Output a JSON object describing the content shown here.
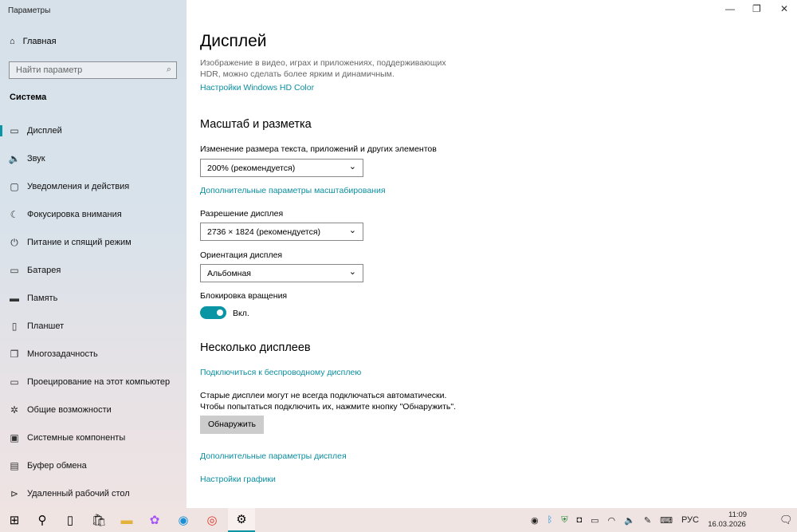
{
  "window": {
    "title": "Параметры",
    "minimize": "—",
    "restore": "❐",
    "close": "✕"
  },
  "sidebar": {
    "home": "Главная",
    "search_placeholder": "Найти параметр",
    "section": "Система",
    "items": [
      {
        "label": "Дисплей",
        "icon": "monitor-icon"
      },
      {
        "label": "Звук",
        "icon": "speaker-icon"
      },
      {
        "label": "Уведомления и действия",
        "icon": "notification-icon"
      },
      {
        "label": "Фокусировка внимания",
        "icon": "moon-icon"
      },
      {
        "label": "Питание и спящий режим",
        "icon": "power-icon"
      },
      {
        "label": "Батарея",
        "icon": "battery-icon"
      },
      {
        "label": "Память",
        "icon": "storage-icon"
      },
      {
        "label": "Планшет",
        "icon": "tablet-icon"
      },
      {
        "label": "Многозадачность",
        "icon": "multitask-icon"
      },
      {
        "label": "Проецирование на этот компьютер",
        "icon": "project-icon"
      },
      {
        "label": "Общие возможности",
        "icon": "shared-icon"
      },
      {
        "label": "Системные компоненты",
        "icon": "components-icon"
      },
      {
        "label": "Буфер обмена",
        "icon": "clipboard-icon"
      },
      {
        "label": "Удаленный рабочий стол",
        "icon": "remote-icon"
      }
    ]
  },
  "main": {
    "title": "Дисплей",
    "hdr_desc1": "Изображение в видео, играх и приложениях, поддерживающих",
    "hdr_desc2": "HDR, можно сделать более ярким и динамичным.",
    "hdr_link": "Настройки Windows HD Color",
    "scale_heading": "Масштаб и разметка",
    "scale_label": "Изменение размера текста, приложений и других элементов",
    "scale_value": "200% (рекомендуется)",
    "scale_link": "Дополнительные параметры масштабирования",
    "res_label": "Разрешение дисплея",
    "res_value": "2736 × 1824 (рекомендуется)",
    "orient_label": "Ориентация дисплея",
    "orient_value": "Альбомная",
    "rot_label": "Блокировка вращения",
    "rot_state": "Вкл.",
    "rot_on": true,
    "multi_heading": "Несколько дисплеев",
    "wireless_link": "Подключиться к беспроводному дисплею",
    "old_desc1": "Старые дисплеи могут не всегда подключаться автоматически.",
    "old_desc2": "Чтобы попытаться подключить их, нажмите кнопку \"Обнаружить\".",
    "detect_button": "Обнаружить",
    "adv_link": "Дополнительные параметры дисплея",
    "graphics_link": "Настройки графики"
  },
  "taskbar": {
    "lang": "РУС",
    "time": "11:09",
    "date": "16.03.2026",
    "accent": "#0a95a5"
  }
}
